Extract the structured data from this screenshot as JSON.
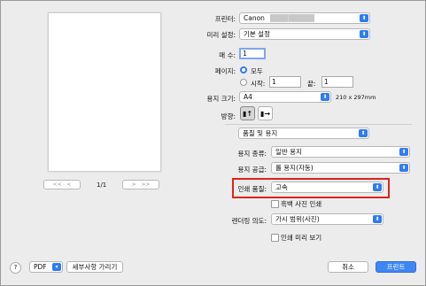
{
  "preview": {
    "page_indicator": "1/1"
  },
  "form": {
    "printer": {
      "label": "프린터:",
      "value": "Canon",
      "redacted": "████ ██████"
    },
    "presets": {
      "label": "미리 설정:",
      "value": "기본 설정"
    },
    "copies": {
      "label": "매 수:",
      "value": "1"
    },
    "pages": {
      "label": "페이지:",
      "all_label": "모두",
      "from_label": "시작:",
      "from_value": "1",
      "to_label": "끝:",
      "to_value": "1"
    },
    "paper_size": {
      "label": "용지 크기:",
      "value": "A4",
      "dims": "210 x 297mm"
    },
    "orientation": {
      "label": "방향:"
    },
    "section": {
      "value": "품질 및 용지"
    },
    "media_type": {
      "label": "용지 종류:",
      "value": "일반 용지"
    },
    "paper_source": {
      "label": "용지 공급:",
      "value": "롤 용지(자동)"
    },
    "print_quality": {
      "label": "인쇄 품질:",
      "value": "고속"
    },
    "grayscale": {
      "label": "흑백 사진 인쇄"
    },
    "rendering": {
      "label": "렌더링 의도:",
      "value": "가시 범위(사진)"
    },
    "print_preview": {
      "label": "인쇄 미리 보기"
    }
  },
  "footer": {
    "help": "?",
    "pdf": "PDF",
    "hide_details": "세부사항 가리기",
    "cancel": "취소",
    "print": "프린트"
  },
  "colors": {
    "accent": "#2d7cf6",
    "highlight": "#e0221b"
  }
}
